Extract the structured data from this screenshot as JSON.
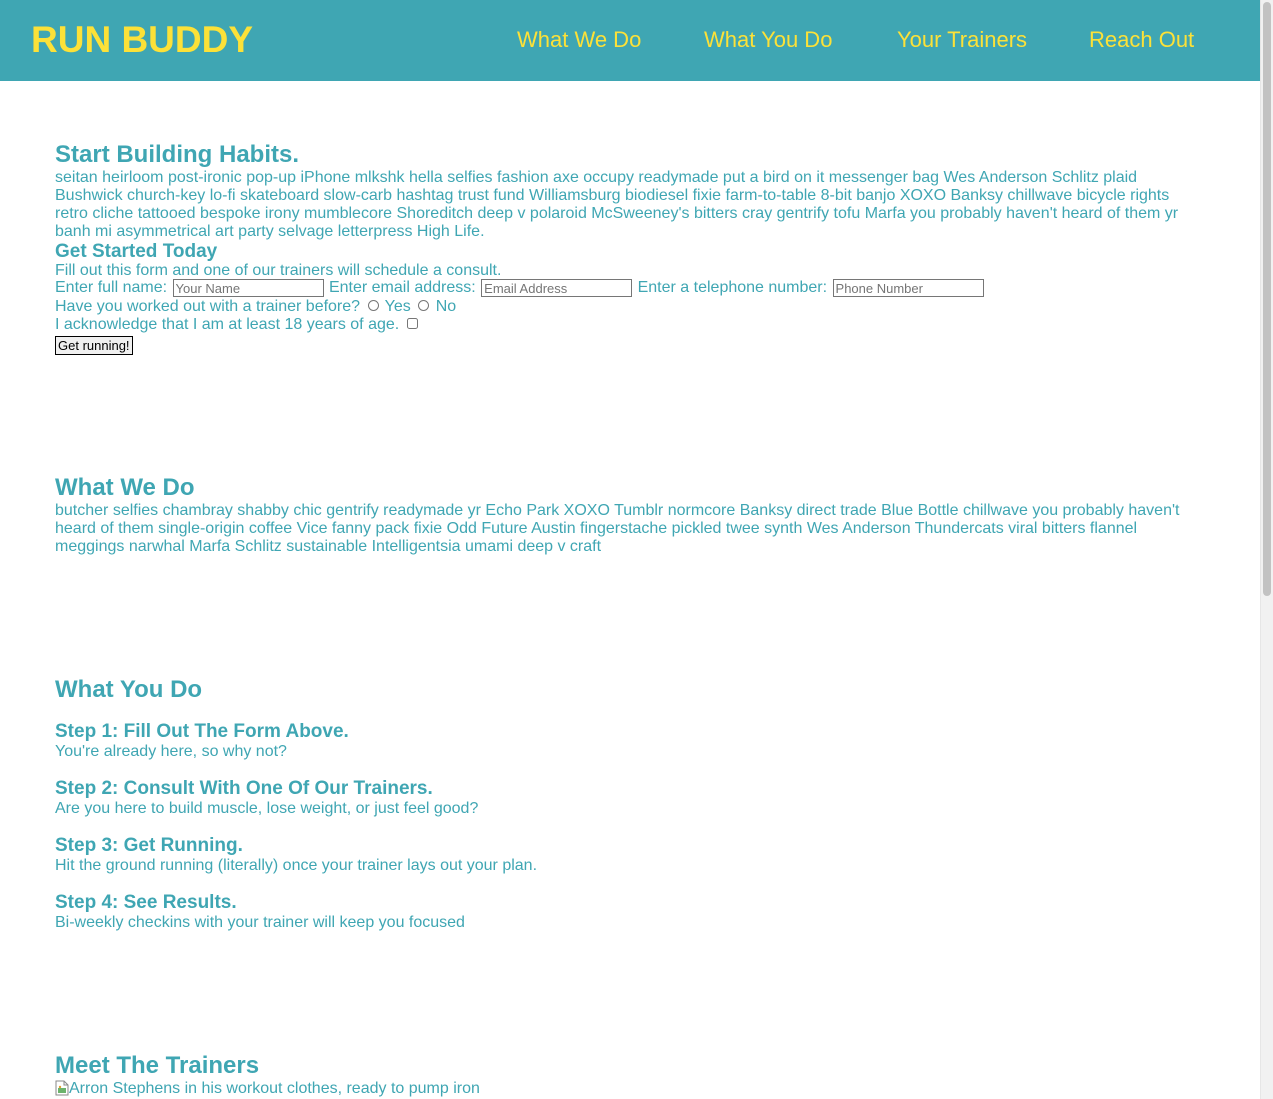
{
  "header": {
    "brand": "RUN BUDDY",
    "nav": [
      {
        "label": "What We Do"
      },
      {
        "label": "What You Do"
      },
      {
        "label": "Your Trainers"
      },
      {
        "label": "Reach Out"
      }
    ]
  },
  "hero": {
    "title": "Start Building Habits.",
    "text": "seitan heirloom post-ironic pop-up iPhone mlkshk hella selfies fashion axe occupy readymade put a bird on it messenger bag Wes Anderson Schlitz plaid Bushwick church-key lo-fi skateboard slow-carb hashtag trust fund Williamsburg biodiesel fixie farm-to-table 8-bit banjo XOXO Banksy chillwave bicycle rights retro cliche tattooed bespoke irony mumblecore Shoreditch deep v polaroid McSweeney's bitters cray gentrify tofu Marfa you probably haven't heard of them yr banh mi asymmetrical art party selvage letterpress High Life."
  },
  "form": {
    "title": "Get Started Today",
    "intro": "Fill out this form and one of our trainers will schedule a consult.",
    "name_label": "Enter full name:",
    "name_placeholder": "Your Name",
    "email_label": "Enter email address:",
    "email_placeholder": "Email Address",
    "phone_label": "Enter a telephone number:",
    "phone_placeholder": "Phone Number",
    "trainer_question": "Have you worked out with a trainer before?",
    "yes_label": "Yes",
    "no_label": "No",
    "age_label": "I acknowledge that I am at least 18 years of age.",
    "submit_label": "Get running!"
  },
  "what_we_do": {
    "title": "What We Do",
    "text": "butcher selfies chambray shabby chic gentrify readymade yr Echo Park XOXO Tumblr normcore Banksy direct trade Blue Bottle chillwave you probably haven't heard of them single-origin coffee Vice fanny pack fixie Odd Future Austin fingerstache pickled twee synth Wes Anderson Thundercats viral bitters flannel meggings narwhal Marfa Schlitz sustainable Intelligentsia umami deep v craft"
  },
  "what_you_do": {
    "title": "What You Do",
    "steps": [
      {
        "title": "Step 1: Fill Out The Form Above.",
        "text": "You're already here, so why not?"
      },
      {
        "title": "Step 2: Consult With One Of Our Trainers.",
        "text": "Are you here to build muscle, lose weight, or just feel good?"
      },
      {
        "title": "Step 3: Get Running.",
        "text": "Hit the ground running (literally) once your trainer lays out your plan."
      },
      {
        "title": "Step 4: See Results.",
        "text": "Bi-weekly checkins with your trainer will keep you focused"
      }
    ]
  },
  "trainers": {
    "title": "Meet The Trainers",
    "image_alt": "Arron Stephens in his workout clothes, ready to pump iron"
  },
  "colors": {
    "primary": "#3fa6b3",
    "accent": "#fce138"
  },
  "icons": {
    "broken_image": "broken-image-icon"
  }
}
